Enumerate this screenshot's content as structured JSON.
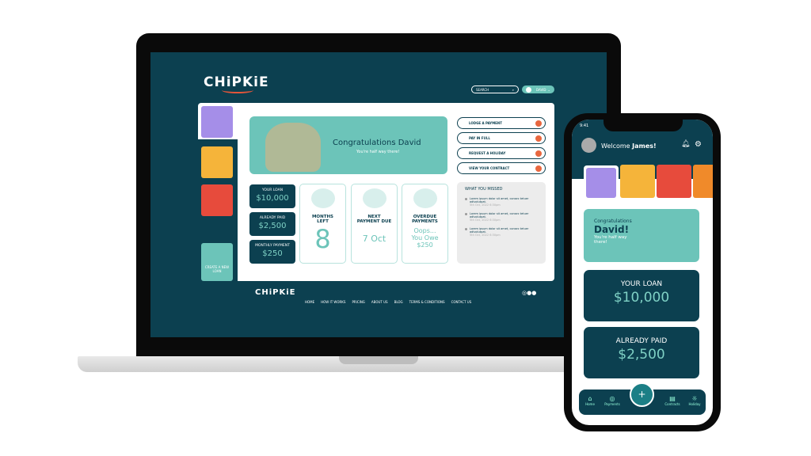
{
  "desktop": {
    "logo": "CHiPKiE",
    "search_placeholder": "SEARCH",
    "user": "DAVID",
    "banner": {
      "title": "Congratulations David",
      "subtitle": "You're half way there!"
    },
    "actions": [
      "LODGE A PAYMENT",
      "PAY IN FULL",
      "REQUEST A HOLIDAY",
      "VIEW YOUR CONTRACT"
    ],
    "stats": [
      {
        "label": "YOUR LOAN",
        "value": "$10,000"
      },
      {
        "label": "ALREADY PAID",
        "value": "$2,500"
      },
      {
        "label": "MONTHLY PAYMENT",
        "value": "$250"
      }
    ],
    "cards": [
      {
        "label": "MONTHS LEFT",
        "value": "8"
      },
      {
        "label": "NEXT PAYMENT DUE",
        "value": "7 Oct"
      },
      {
        "label": "OVERDUE PAYMENTS",
        "value": "Oops... You Owe $250"
      }
    ],
    "missed": {
      "title": "WHAT YOU MISSED",
      "items": [
        {
          "text": "Lorem ipsum dolor sit amet, consec tetuer adivolutpat.",
          "time": "5th Oct, 2022 6:30pm"
        },
        {
          "text": "Lorem ipsum dolor sit amet, consec tetuer adivolutpat.",
          "time": "5th Oct, 2022 6:30pm"
        },
        {
          "text": "Lorem ipsum dolor sit amet, consec tetuer adivolutpat.",
          "time": "5th Oct, 2022 6:30pm"
        }
      ]
    },
    "create_loan": "CREATE A NEW LOAN",
    "footer": {
      "logo": "CHiPKiE",
      "links": [
        "HOME",
        "HOW IT WORKS",
        "PRICING",
        "ABOUT US",
        "BLOG",
        "TERMS & CONDITIONS",
        "CONTACT US"
      ]
    }
  },
  "phone": {
    "time": "9:41",
    "welcome": "Welcome",
    "name": "James!",
    "banner": {
      "line1": "Congratulations",
      "line2": "David!",
      "sub": "You're half way there!"
    },
    "stats": [
      {
        "label": "YOUR LOAN",
        "value": "$10,000"
      },
      {
        "label": "ALREADY PAID",
        "value": "$2,500"
      }
    ],
    "nav": [
      "Home",
      "Payments",
      "+",
      "Contracts",
      "Holiday"
    ]
  },
  "colors": {
    "primary": "#0c4050",
    "accent": "#6cc4b9",
    "action": "#e8673f"
  }
}
